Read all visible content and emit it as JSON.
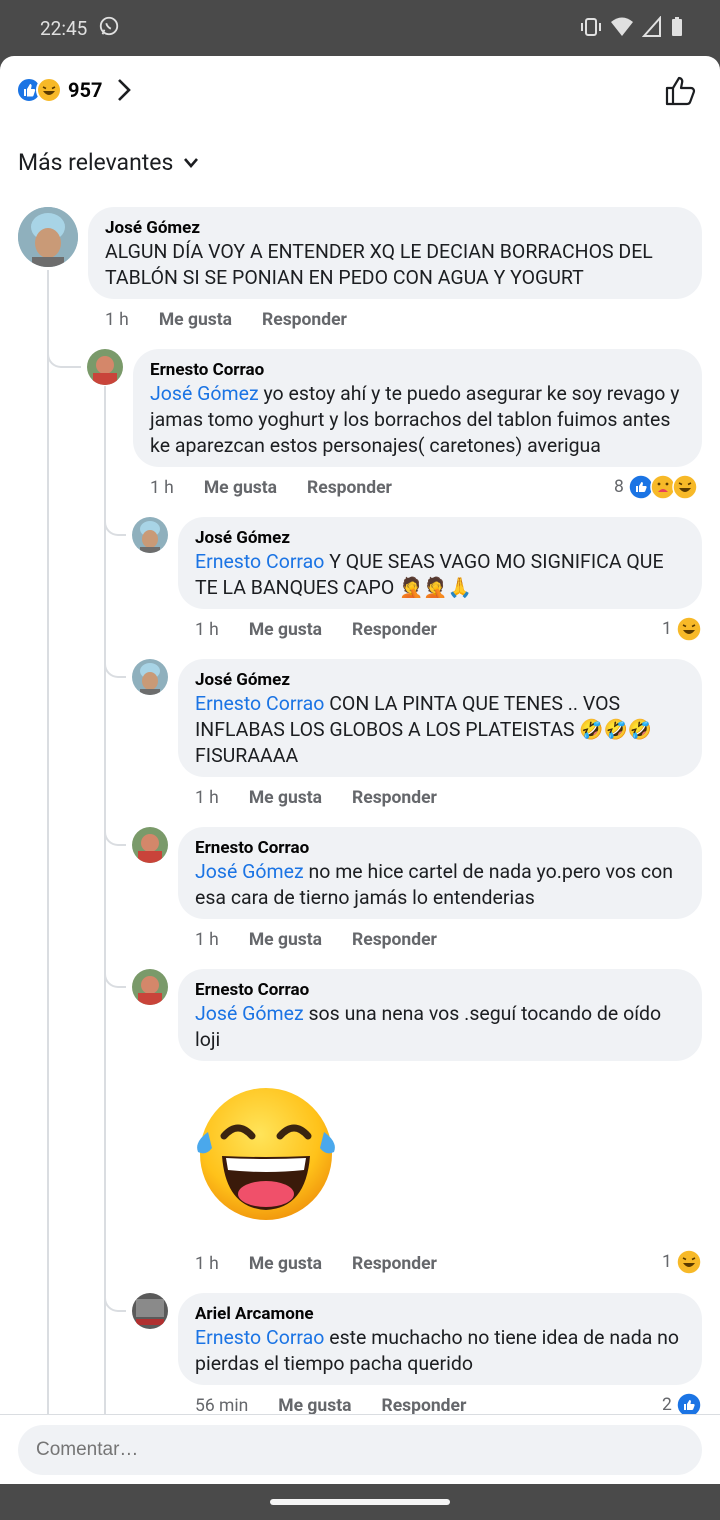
{
  "status_bar": {
    "time": "22:45"
  },
  "header": {
    "reaction_count": "957"
  },
  "sort": {
    "label": "Más relevantes"
  },
  "comments": [
    {
      "author": "José Gómez",
      "text": "ALGUN DÍA VOY A ENTENDER XQ LE DECIAN BORRACHOS DEL TABLÓN SI SE PONIAN EN PEDO CON AGUA Y YOGURT",
      "time": "1 h",
      "like": "Me gusta",
      "reply": "Responder"
    },
    {
      "author": "Ernesto Corrao",
      "mention": "José Gómez",
      "text": " yo estoy ahí y te puedo asegurar ke soy revago y jamas tomo yoghurt y los borrachos del tablon fuimos antes ke aparezcan estos personajes( caretones) averigua",
      "time": "1 h",
      "like": "Me gusta",
      "reply": "Responder",
      "reaction_count": "8"
    },
    {
      "author": "José Gómez",
      "mention": "Ernesto Corrao",
      "text": " Y QUE SEAS VAGO MO SIGNIFICA QUE TE LA BANQUES CAPO 🤦🤦🙏",
      "time": "1 h",
      "like": "Me gusta",
      "reply": "Responder",
      "reaction_count": "1"
    },
    {
      "author": "José Gómez",
      "mention": "Ernesto Corrao",
      "text": " CON LA PINTA QUE TENES .. VOS INFLABAS LOS GLOBOS A LOS PLATEISTAS 🤣🤣🤣 FISURAAAA",
      "time": "1 h",
      "like": "Me gusta",
      "reply": "Responder"
    },
    {
      "author": "Ernesto Corrao",
      "mention": "José Gómez",
      "text": " no me hice cartel de nada yo.pero vos con esa cara de tierno jamás lo entenderias",
      "time": "1 h",
      "like": "Me gusta",
      "reply": "Responder"
    },
    {
      "author": "Ernesto Corrao",
      "mention": "José Gómez",
      "text": " sos una nena vos .seguí tocando de oído loji",
      "time": "1 h",
      "like": "Me gusta",
      "reply": "Responder",
      "reaction_count": "1"
    },
    {
      "author": "Ariel Arcamone",
      "mention": "Ernesto Corrao",
      "text": " este muchacho no tiene idea de nada no pierdas el tiempo pacha querido",
      "time": "56 min",
      "like": "Me gusta",
      "reply": "Responder",
      "reaction_count": "2"
    }
  ],
  "composer": {
    "placeholder": "Comentar…"
  },
  "colors": {
    "accent": "#1b74e4",
    "bubble": "#f0f2f5",
    "meta": "#65676b"
  }
}
